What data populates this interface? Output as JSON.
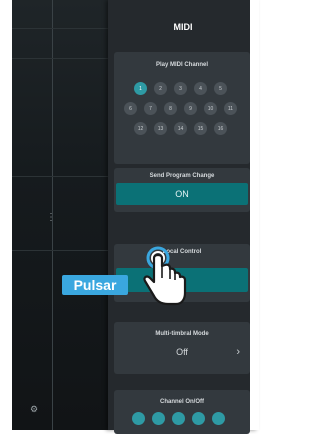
{
  "panel": {
    "title": "MIDI",
    "play_channel": {
      "label": "Play MIDI Channel",
      "channels": [
        "1",
        "2",
        "3",
        "4",
        "5",
        "6",
        "7",
        "8",
        "9",
        "10",
        "11",
        "12",
        "13",
        "14",
        "15",
        "16"
      ],
      "active_channel": "1"
    },
    "send_program_change": {
      "label": "Send Program Change",
      "value": "ON"
    },
    "local_control": {
      "label": "Local Control"
    },
    "multi_timbral": {
      "label": "Multi-timbral Mode",
      "value": "Off"
    },
    "channel_onoff": {
      "label": "Channel On/Off"
    }
  },
  "overlay": {
    "tap_label": "Pulsar"
  },
  "icons": {
    "hand": "hand-pointer-icon",
    "chevron": "chevron-right-icon"
  },
  "colors": {
    "accent": "#0b7176",
    "active_channel": "#2e9aa4",
    "tap_label_bg": "#3aa7df"
  }
}
